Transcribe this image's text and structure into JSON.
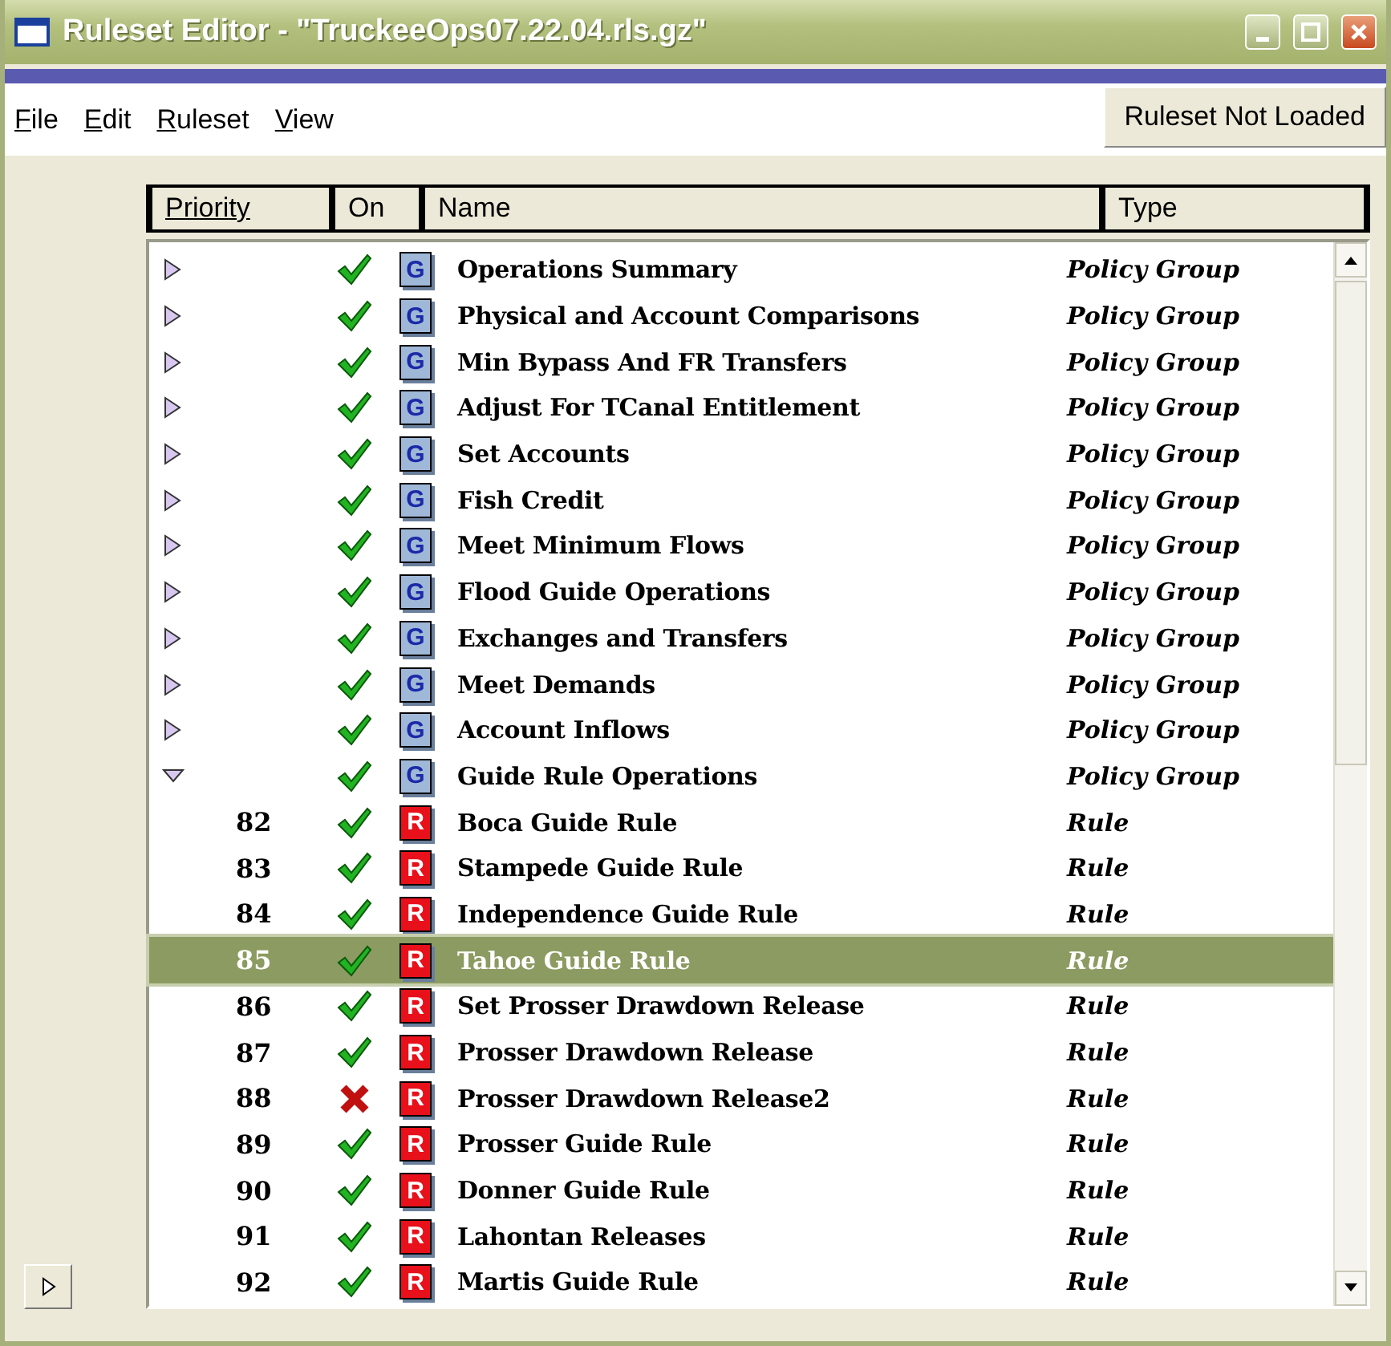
{
  "window": {
    "title": "Ruleset Editor  - \"TruckeeOps07.22.04.rls.gz\""
  },
  "menu": [
    {
      "label": "File"
    },
    {
      "label": "Edit"
    },
    {
      "label": "Ruleset"
    },
    {
      "label": "View"
    }
  ],
  "status_button": "Ruleset Not Loaded",
  "columns": [
    "Priority",
    "On",
    "Name",
    "Type"
  ],
  "rows": [
    {
      "kind": "group",
      "expanded": false,
      "on": true,
      "badge": "G",
      "name": "Operations Summary",
      "type": "Policy Group",
      "selected": false
    },
    {
      "kind": "group",
      "expanded": false,
      "on": true,
      "badge": "G",
      "name": "Physical and Account Comparisons",
      "type": "Policy Group",
      "selected": false
    },
    {
      "kind": "group",
      "expanded": false,
      "on": true,
      "badge": "G",
      "name": "Min Bypass And FR Transfers",
      "type": "Policy Group",
      "selected": false
    },
    {
      "kind": "group",
      "expanded": false,
      "on": true,
      "badge": "G",
      "name": "Adjust  For TCanal Entitlement",
      "type": "Policy Group",
      "selected": false
    },
    {
      "kind": "group",
      "expanded": false,
      "on": true,
      "badge": "G",
      "name": "Set Accounts",
      "type": "Policy Group",
      "selected": false
    },
    {
      "kind": "group",
      "expanded": false,
      "on": true,
      "badge": "G",
      "name": "Fish Credit",
      "type": "Policy Group",
      "selected": false
    },
    {
      "kind": "group",
      "expanded": false,
      "on": true,
      "badge": "G",
      "name": "Meet Minimum Flows",
      "type": "Policy Group",
      "selected": false
    },
    {
      "kind": "group",
      "expanded": false,
      "on": true,
      "badge": "G",
      "name": "Flood Guide Operations",
      "type": "Policy Group",
      "selected": false
    },
    {
      "kind": "group",
      "expanded": false,
      "on": true,
      "badge": "G",
      "name": "Exchanges and Transfers",
      "type": "Policy Group",
      "selected": false
    },
    {
      "kind": "group",
      "expanded": false,
      "on": true,
      "badge": "G",
      "name": "Meet Demands",
      "type": "Policy Group",
      "selected": false
    },
    {
      "kind": "group",
      "expanded": false,
      "on": true,
      "badge": "G",
      "name": "Account Inflows",
      "type": "Policy Group",
      "selected": false
    },
    {
      "kind": "group",
      "expanded": true,
      "on": true,
      "badge": "G",
      "name": "Guide Rule Operations",
      "type": "Policy Group",
      "selected": false
    },
    {
      "kind": "rule",
      "priority": "82",
      "on": true,
      "badge": "R",
      "name": "Boca Guide Rule",
      "type": "Rule",
      "selected": false
    },
    {
      "kind": "rule",
      "priority": "83",
      "on": true,
      "badge": "R",
      "name": "Stampede Guide Rule",
      "type": "Rule",
      "selected": false
    },
    {
      "kind": "rule",
      "priority": "84",
      "on": true,
      "badge": "R",
      "name": "Independence Guide Rule",
      "type": "Rule",
      "selected": false
    },
    {
      "kind": "rule",
      "priority": "85",
      "on": true,
      "badge": "R",
      "name": "Tahoe Guide Rule",
      "type": "Rule",
      "selected": true
    },
    {
      "kind": "rule",
      "priority": "86",
      "on": true,
      "badge": "R",
      "name": "Set Prosser Drawdown Release",
      "type": "Rule",
      "selected": false
    },
    {
      "kind": "rule",
      "priority": "87",
      "on": true,
      "badge": "R",
      "name": "Prosser Drawdown Release",
      "type": "Rule",
      "selected": false
    },
    {
      "kind": "rule",
      "priority": "88",
      "on": false,
      "badge": "R",
      "name": "Prosser Drawdown Release2",
      "type": "Rule",
      "selected": false
    },
    {
      "kind": "rule",
      "priority": "89",
      "on": true,
      "badge": "R",
      "name": "Prosser Guide Rule",
      "type": "Rule",
      "selected": false
    },
    {
      "kind": "rule",
      "priority": "90",
      "on": true,
      "badge": "R",
      "name": "Donner Guide Rule",
      "type": "Rule",
      "selected": false
    },
    {
      "kind": "rule",
      "priority": "91",
      "on": true,
      "badge": "R",
      "name": "Lahontan Releases",
      "type": "Rule",
      "selected": false
    },
    {
      "kind": "rule",
      "priority": "92",
      "on": true,
      "badge": "R",
      "name": "Martis Guide Rule",
      "type": "Rule",
      "selected": false
    }
  ]
}
